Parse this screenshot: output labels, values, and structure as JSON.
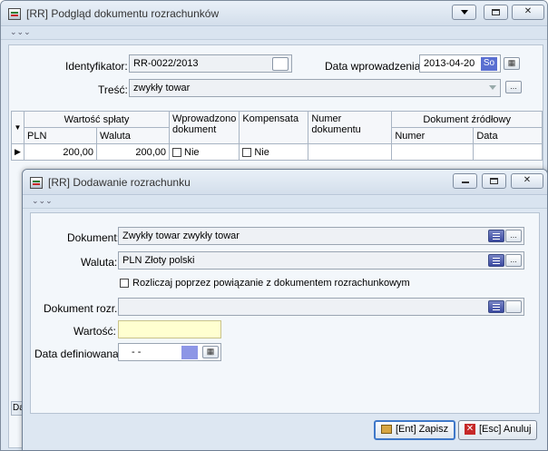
{
  "main_window": {
    "title": "[RR] Podgląd dokumentu rozrachunków",
    "identyfikator_label": "Identyfikator:",
    "identyfikator_value": "RR-0022/2013",
    "data_wprowadzenia_label": "Data wprowadzenia:",
    "data_wprowadzenia_value": "2013-04-20",
    "day_badge": "So",
    "tresc_label": "Treść:",
    "tresc_value": "zwykły towar",
    "ellipsis": "...",
    "grid": {
      "headers": {
        "wartosc_splaty": "Wartość spłaty",
        "pln": "PLN",
        "waluta": "Waluta",
        "wprowadzono_dokument": "Wprowadzono dokument",
        "kompensata": "Kompensata",
        "numer_dokumentu": "Numer dokumentu",
        "dokument_zrodlowy": "Dokument źródłowy",
        "numer": "Numer",
        "data": "Data"
      },
      "row": {
        "pln": "200,00",
        "waluta": "200,00",
        "wprowadzono": "Nie",
        "kompensata": "Nie"
      }
    },
    "bottom_tab": "Da"
  },
  "dialog": {
    "title": "[RR] Dodawanie rozrachunku",
    "dokument_label": "Dokument:",
    "dokument_value": "Zwykły towar zwykły towar",
    "waluta_label": "Waluta:",
    "waluta_value": "PLN Złoty polski",
    "rozliczaj_label": "Rozliczaj poprzez powiązanie z dokumentem rozrachunkowym",
    "dokument_rozr_label": "Dokument rozr.:",
    "wartosc_label": "Wartość:",
    "wartosc_value": "",
    "data_def_label": "Data definiowana:",
    "data_def_value": "-   -",
    "ellipsis": "...",
    "save_label": "[Ent] Zapisz",
    "cancel_label": "[Esc] Anuluj"
  }
}
